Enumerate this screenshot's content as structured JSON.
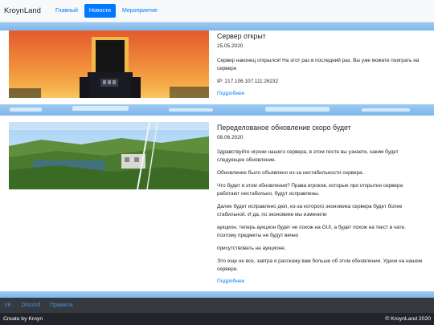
{
  "navbar": {
    "brand": "KroynLand",
    "links": [
      {
        "label": "Главный"
      },
      {
        "label": "Новости"
      },
      {
        "label": "Мероприятие"
      }
    ]
  },
  "posts": [
    {
      "title": "Сервер открыт",
      "date": "25.05.2020",
      "paragraphs": [
        "Сервер наконец открылся! На этот раз в последний раз. Вы уже можете поиграть на сервере",
        "IP: 217.106.107.111:26232"
      ],
      "more": "Подробнее"
    },
    {
      "title": "Переделованое обновление скоро будет",
      "date": "08.06.2020",
      "paragraphs": [
        "Здравствуйте игроки нашего сервера, в этом посте вы узнаете, каким будет следующее обновление.",
        "Обновление было объявлено из-за нестабильности сервера.",
        "Что будет в этом обновлении? Права игроков, которые при открытии сервера работают нестабильно, будут исправлены.",
        "Далее будет исправлено дюп, из-за которого экономика сервера будет более стабильной. И да, по экономике мы изменили",
        "аукцион, теперь аукцион будет не похож на GUI, а будет похож на текст в чате, поэтому предметы не будут вечно",
        "присутствовать на аукционе.",
        "Это еще не все, завтра я расскажу вам больше об этом обновлении. Удачи на нашем сервере."
      ],
      "more": "Подробнее"
    }
  ],
  "footer": {
    "links": [
      {
        "label": "VK"
      },
      {
        "label": "Discord"
      },
      {
        "label": "Правила"
      }
    ],
    "left": "Create by Kroyn",
    "right": "© KroynLand 2020"
  }
}
